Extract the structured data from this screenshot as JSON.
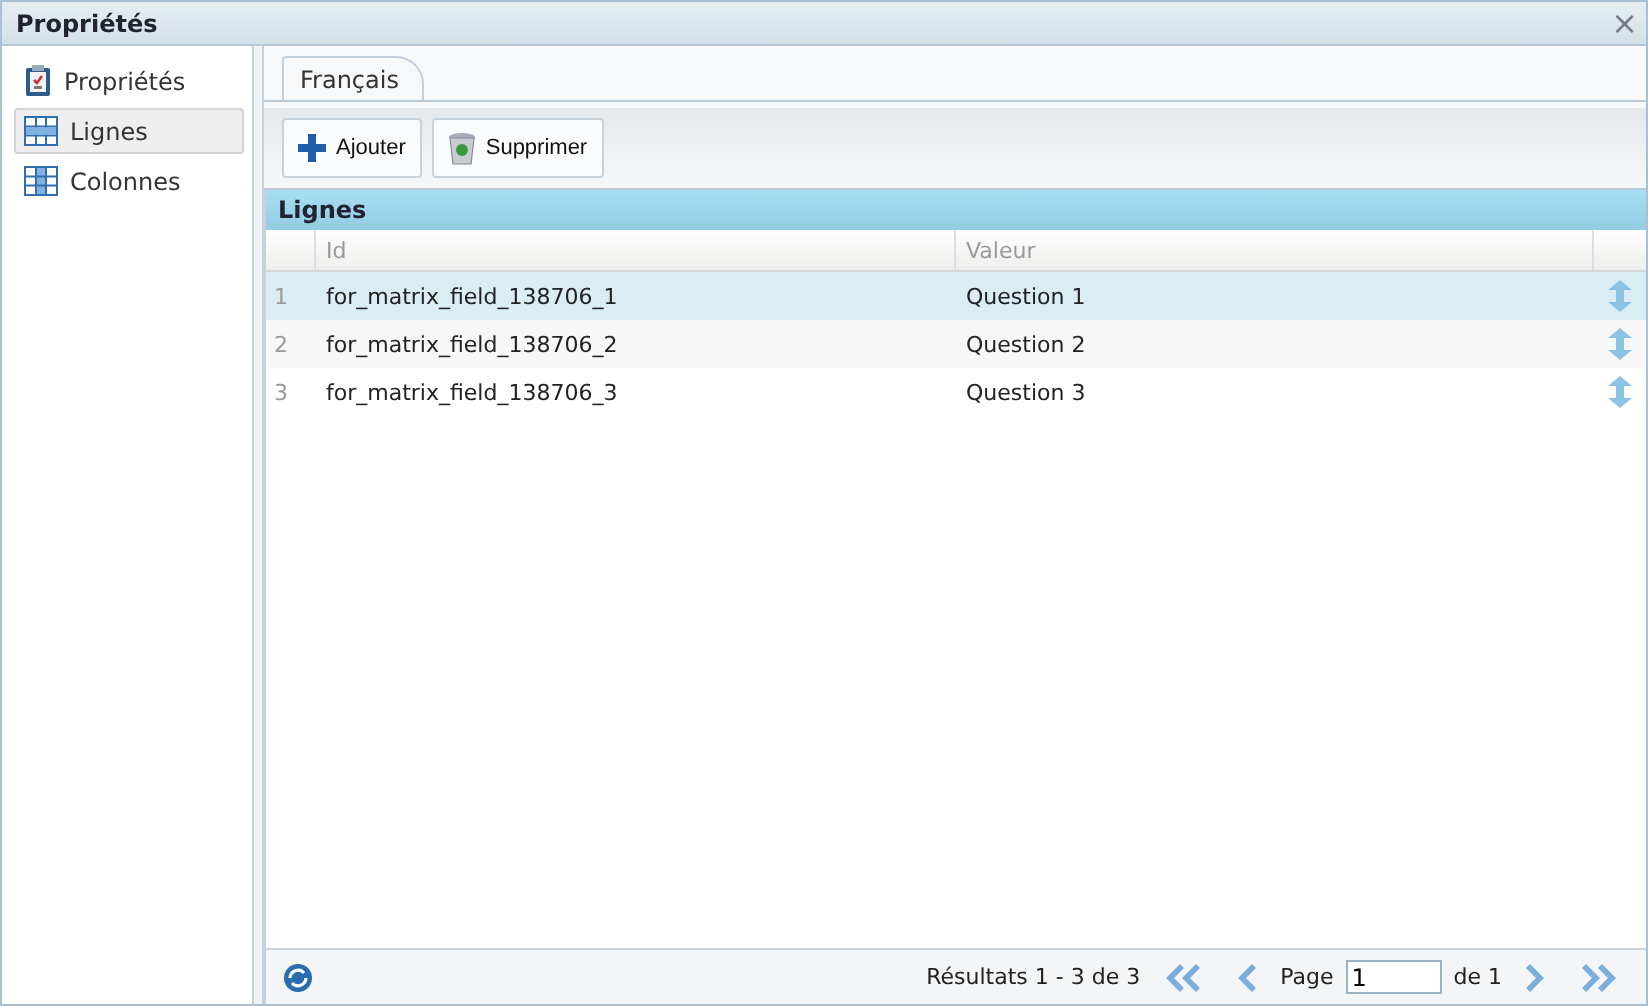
{
  "window": {
    "title": "Propriétés",
    "close": "×"
  },
  "sidebar": {
    "items": [
      {
        "label": "Propriétés",
        "kind": "clipboard",
        "selected": false
      },
      {
        "label": "Lignes",
        "kind": "rows",
        "selected": true
      },
      {
        "label": "Colonnes",
        "kind": "columns",
        "selected": false
      }
    ]
  },
  "tabs": [
    {
      "label": "Français",
      "selected": true
    }
  ],
  "toolbar": {
    "buttons": [
      {
        "label": "Ajouter",
        "kind": "add"
      },
      {
        "label": "Supprimer",
        "kind": "delete"
      }
    ]
  },
  "grid": {
    "title": "Lignes",
    "columns": [
      "Id",
      "Valeur"
    ],
    "rows": [
      {
        "number": "1",
        "id": "for_matrix_field_138706_1",
        "value": "Question 1",
        "selected": true
      },
      {
        "number": "2",
        "id": "for_matrix_field_138706_2",
        "value": "Question 2",
        "selected": false
      },
      {
        "number": "3",
        "id": "for_matrix_field_138706_3",
        "value": "Question 3",
        "selected": false
      }
    ]
  },
  "pager": {
    "summary": "Résultats 1 - 3 de 3",
    "page_label": "Page",
    "page_value": "1",
    "of_label": "de 1"
  }
}
